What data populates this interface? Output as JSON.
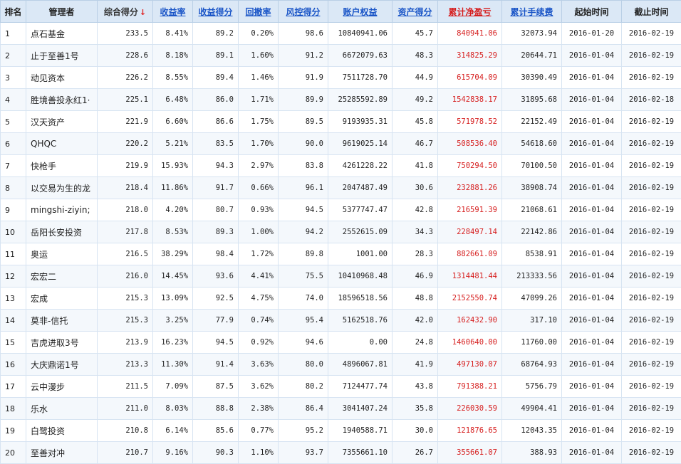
{
  "headers": [
    {
      "label": "排名",
      "style": "plain"
    },
    {
      "label": "管理者",
      "style": "plain"
    },
    {
      "label": "综合得分",
      "style": "sorted",
      "arrow": "↓"
    },
    {
      "label": "收益率",
      "style": "sortable"
    },
    {
      "label": "收益得分",
      "style": "sortable"
    },
    {
      "label": "回撤率",
      "style": "sortable"
    },
    {
      "label": "风控得分",
      "style": "sortable"
    },
    {
      "label": "账户权益",
      "style": "sortable"
    },
    {
      "label": "资产得分",
      "style": "sortable"
    },
    {
      "label": "累计净盈亏",
      "style": "sortable red-head"
    },
    {
      "label": "累计手续费",
      "style": "sortable"
    },
    {
      "label": "起始时间",
      "style": "plain"
    },
    {
      "label": "截止时间",
      "style": "plain"
    }
  ],
  "rows": [
    [
      "1",
      "点石基金",
      "233.5",
      "8.41%",
      "89.2",
      "0.20%",
      "98.6",
      "10840941.06",
      "45.7",
      "840941.06",
      "32073.94",
      "2016-01-20",
      "2016-02-19"
    ],
    [
      "2",
      "止于至善1号",
      "228.6",
      "8.18%",
      "89.1",
      "1.60%",
      "91.2",
      "6672079.63",
      "48.3",
      "314825.29",
      "20644.71",
      "2016-01-04",
      "2016-02-19"
    ],
    [
      "3",
      "动见资本",
      "226.2",
      "8.55%",
      "89.4",
      "1.46%",
      "91.9",
      "7511728.70",
      "44.9",
      "615704.09",
      "30390.49",
      "2016-01-04",
      "2016-02-19"
    ],
    [
      "4",
      "胜境善投永红1·",
      "225.1",
      "6.48%",
      "86.0",
      "1.71%",
      "89.9",
      "25285592.89",
      "49.2",
      "1542838.17",
      "31895.68",
      "2016-01-04",
      "2016-02-18"
    ],
    [
      "5",
      "汉天资产",
      "221.9",
      "6.60%",
      "86.6",
      "1.75%",
      "89.5",
      "9193935.31",
      "45.8",
      "571978.52",
      "22152.49",
      "2016-01-04",
      "2016-02-19"
    ],
    [
      "6",
      "QHQC",
      "220.2",
      "5.21%",
      "83.5",
      "1.70%",
      "90.0",
      "9619025.14",
      "46.7",
      "508536.40",
      "54618.60",
      "2016-01-04",
      "2016-02-19"
    ],
    [
      "7",
      "快枪手",
      "219.9",
      "15.93%",
      "94.3",
      "2.97%",
      "83.8",
      "4261228.22",
      "41.8",
      "750294.50",
      "70100.50",
      "2016-01-04",
      "2016-02-19"
    ],
    [
      "8",
      "以交易为生的龙",
      "218.4",
      "11.86%",
      "91.7",
      "0.66%",
      "96.1",
      "2047487.49",
      "30.6",
      "232881.26",
      "38908.74",
      "2016-01-04",
      "2016-02-19"
    ],
    [
      "9",
      "mingshi-ziyin;",
      "218.0",
      "4.20%",
      "80.7",
      "0.93%",
      "94.5",
      "5377747.47",
      "42.8",
      "216591.39",
      "21068.61",
      "2016-01-04",
      "2016-02-19"
    ],
    [
      "10",
      "岳阳长安投资",
      "217.8",
      "8.53%",
      "89.3",
      "1.00%",
      "94.2",
      "2552615.09",
      "34.3",
      "228497.14",
      "22142.86",
      "2016-01-04",
      "2016-02-19"
    ],
    [
      "11",
      "奥运",
      "216.5",
      "38.29%",
      "98.4",
      "1.72%",
      "89.8",
      "1001.00",
      "28.3",
      "882661.09",
      "8538.91",
      "2016-01-04",
      "2016-02-19"
    ],
    [
      "12",
      "宏宏二",
      "216.0",
      "14.45%",
      "93.6",
      "4.41%",
      "75.5",
      "10410968.48",
      "46.9",
      "1314481.44",
      "213333.56",
      "2016-01-04",
      "2016-02-19"
    ],
    [
      "13",
      "宏成",
      "215.3",
      "13.09%",
      "92.5",
      "4.75%",
      "74.0",
      "18596518.56",
      "48.8",
      "2152550.74",
      "47099.26",
      "2016-01-04",
      "2016-02-19"
    ],
    [
      "14",
      "莫非-信托",
      "215.3",
      "3.25%",
      "77.9",
      "0.74%",
      "95.4",
      "5162518.76",
      "42.0",
      "162432.90",
      "317.10",
      "2016-01-04",
      "2016-02-19"
    ],
    [
      "15",
      "吉虎进取3号",
      "213.9",
      "16.23%",
      "94.5",
      "0.92%",
      "94.6",
      "0.00",
      "24.8",
      "1460640.00",
      "11760.00",
      "2016-01-04",
      "2016-02-19"
    ],
    [
      "16",
      "大庆鼎诺1号",
      "213.3",
      "11.30%",
      "91.4",
      "3.63%",
      "80.0",
      "4896067.81",
      "41.9",
      "497130.07",
      "68764.93",
      "2016-01-04",
      "2016-02-19"
    ],
    [
      "17",
      "云中漫步",
      "211.5",
      "7.09%",
      "87.5",
      "3.62%",
      "80.2",
      "7124477.74",
      "43.8",
      "791388.21",
      "5756.79",
      "2016-01-04",
      "2016-02-19"
    ],
    [
      "18",
      "乐水",
      "211.0",
      "8.03%",
      "88.8",
      "2.38%",
      "86.4",
      "3041407.24",
      "35.8",
      "226030.59",
      "49904.41",
      "2016-01-04",
      "2016-02-19"
    ],
    [
      "19",
      "白鹭投资",
      "210.8",
      "6.14%",
      "85.6",
      "0.77%",
      "95.2",
      "1940588.71",
      "30.0",
      "121876.65",
      "12043.35",
      "2016-01-04",
      "2016-02-19"
    ],
    [
      "20",
      "至善对冲",
      "210.7",
      "9.16%",
      "90.3",
      "1.10%",
      "93.7",
      "7355661.10",
      "26.7",
      "355661.07",
      "388.93",
      "2016-01-04",
      "2016-02-19"
    ]
  ],
  "colors": {
    "header_bg": "#dbe8f6",
    "link": "#1a55c7",
    "red": "#d61f1f",
    "border": "#b9cfe6"
  }
}
